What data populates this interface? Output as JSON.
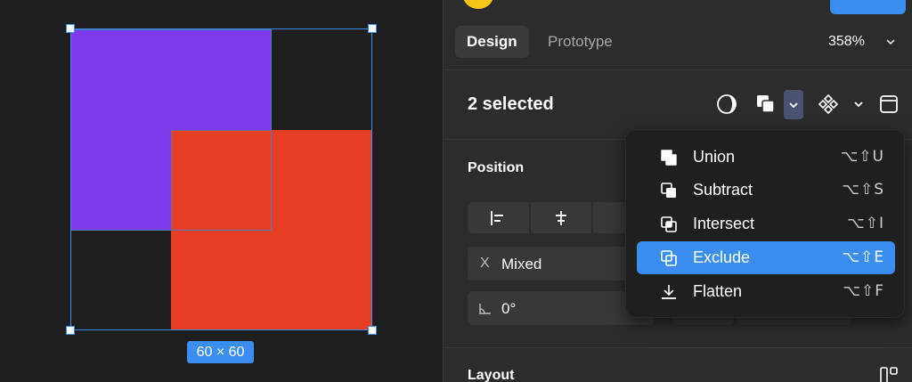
{
  "canvas": {
    "size_label": "60 × 60"
  },
  "tabs": [
    {
      "label": "Design",
      "active": true
    },
    {
      "label": "Prototype",
      "active": false
    }
  ],
  "zoom": "358%",
  "selection": {
    "label": "2 selected"
  },
  "sections": {
    "position": "Position",
    "layout": "Layout"
  },
  "fields": {
    "x_label": "X",
    "x_value": "Mixed",
    "rotation_value": "0°"
  },
  "boolean_menu": {
    "items": [
      {
        "label": "Union",
        "shortcut": "⌥⇧U",
        "icon": "union-icon"
      },
      {
        "label": "Subtract",
        "shortcut": "⌥⇧S",
        "icon": "subtract-icon"
      },
      {
        "label": "Intersect",
        "shortcut": "⌥⇧I",
        "icon": "intersect-icon"
      },
      {
        "label": "Exclude",
        "shortcut": "⌥⇧E",
        "icon": "exclude-icon",
        "highlighted": true
      },
      {
        "label": "Flatten",
        "shortcut": "⌥⇧F",
        "icon": "flatten-icon"
      }
    ]
  },
  "colors": {
    "accent": "#3c8df0",
    "shape_purple": "#7b3aed",
    "shape_red": "#e73f25",
    "panel_bg": "#2c2c2c",
    "canvas_bg": "#1e1e1e"
  }
}
